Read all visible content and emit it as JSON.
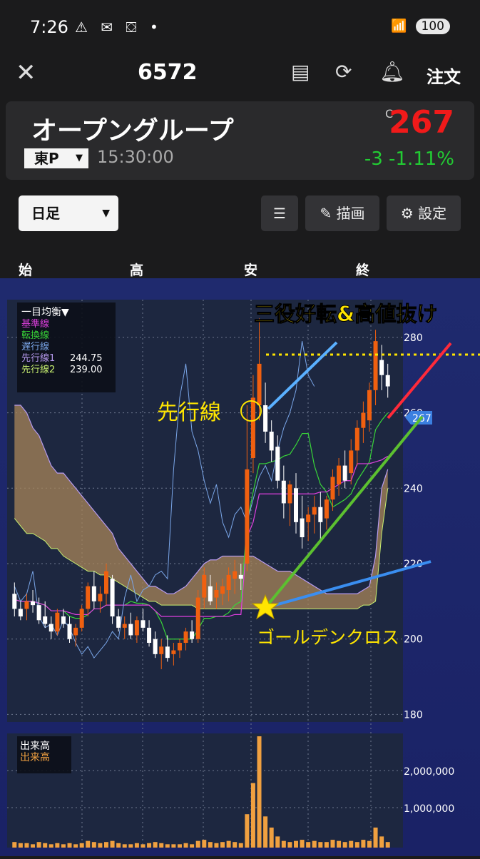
{
  "status_bar": {
    "time": "7:26",
    "icons": [
      "alert-icon",
      "mail-icon",
      "cube-icon",
      "dot-icon"
    ],
    "battery": "100",
    "signal": "5"
  },
  "header": {
    "code": "6572",
    "order_label": "注文"
  },
  "quote": {
    "name": "オープングループ",
    "market": "東P",
    "time": "15:30:00",
    "c_mark": "C",
    "price": "267",
    "change": "-3",
    "change_pct": "-1.11%",
    "price_color": "#f01a1a",
    "change_color": "#22cc33"
  },
  "controls": {
    "period": "日足",
    "draw_label": "描画",
    "settings_label": "設定"
  },
  "ohlc_labels": [
    "始",
    "高",
    "安",
    "終"
  ],
  "legend": {
    "title": "一目均衡▼",
    "kijun": "基準線",
    "tenkan": "転換線",
    "chikou": "遅行線",
    "senkou1": "先行線1",
    "senkou1_val": "244.75",
    "senkou2": "先行線2",
    "senkou2_val": "239.00"
  },
  "annotations": {
    "headline": "三役好転&高値抜け",
    "senko_label": "先行線",
    "golden_cross": "ゴールデンクロス"
  },
  "volume_legend": {
    "line1": "出来高",
    "line2": "出来高"
  },
  "chart_data": {
    "type": "candlestick",
    "y_ticks": [
      200,
      220,
      240,
      260,
      280,
      "280"
    ],
    "y_labels": [
      "280",
      "260",
      "240",
      "220",
      "200",
      "180"
    ],
    "ylim": [
      178,
      290
    ],
    "current_price_tag": "267",
    "volume_ticks": [
      "2,000,000",
      "1,000,000"
    ],
    "candles": [
      [
        212,
        215,
        206,
        208
      ],
      [
        208,
        210,
        205,
        206
      ],
      [
        208,
        212,
        205,
        210
      ],
      [
        210,
        213,
        207,
        209
      ],
      [
        209,
        211,
        204,
        205
      ],
      [
        206,
        210,
        203,
        204
      ],
      [
        204,
        206,
        200,
        202
      ],
      [
        202,
        208,
        201,
        207
      ],
      [
        206,
        208,
        203,
        204
      ],
      [
        204,
        206,
        199,
        200
      ],
      [
        201,
        204,
        198,
        203
      ],
      [
        203,
        209,
        202,
        208
      ],
      [
        208,
        215,
        206,
        214
      ],
      [
        214,
        218,
        208,
        210
      ],
      [
        210,
        214,
        207,
        212
      ],
      [
        212,
        220,
        209,
        218
      ],
      [
        216,
        217,
        204,
        206
      ],
      [
        206,
        208,
        202,
        203
      ],
      [
        203,
        206,
        200,
        204
      ],
      [
        204,
        207,
        200,
        201
      ],
      [
        201,
        206,
        199,
        205
      ],
      [
        205,
        208,
        202,
        203
      ],
      [
        203,
        205,
        198,
        199
      ],
      [
        200,
        202,
        195,
        196
      ],
      [
        196,
        200,
        192,
        198
      ],
      [
        198,
        201,
        194,
        195
      ],
      [
        196,
        199,
        193,
        197
      ],
      [
        197,
        200,
        195,
        199
      ],
      [
        199,
        203,
        197,
        202
      ],
      [
        202,
        205,
        199,
        200
      ],
      [
        200,
        213,
        199,
        211
      ],
      [
        211,
        219,
        208,
        217
      ],
      [
        214,
        217,
        209,
        210
      ],
      [
        211,
        215,
        208,
        213
      ],
      [
        212,
        216,
        209,
        214
      ],
      [
        213,
        219,
        210,
        217
      ],
      [
        216,
        221,
        212,
        218
      ],
      [
        217,
        220,
        213,
        216
      ],
      [
        220,
        262,
        218,
        245
      ],
      [
        248,
        270,
        244,
        264
      ],
      [
        262,
        285,
        258,
        273
      ],
      [
        262,
        268,
        252,
        255
      ],
      [
        255,
        258,
        247,
        250
      ],
      [
        251,
        254,
        240,
        242
      ],
      [
        242,
        246,
        232,
        236
      ],
      [
        236,
        242,
        230,
        241
      ],
      [
        240,
        244,
        228,
        231
      ],
      [
        232,
        238,
        224,
        227
      ],
      [
        231,
        235,
        226,
        233
      ],
      [
        233,
        238,
        228,
        235
      ],
      [
        235,
        239,
        226,
        231
      ],
      [
        232,
        238,
        229,
        237
      ],
      [
        237,
        245,
        234,
        243
      ],
      [
        241,
        248,
        238,
        246
      ],
      [
        246,
        250,
        240,
        242
      ],
      [
        244,
        253,
        241,
        250
      ],
      [
        250,
        258,
        246,
        256
      ],
      [
        256,
        263,
        252,
        260
      ],
      [
        258,
        268,
        255,
        266
      ],
      [
        266,
        282,
        262,
        279
      ],
      [
        274,
        278,
        266,
        270
      ],
      [
        270,
        273,
        264,
        267
      ]
    ],
    "volumes": [
      0.05,
      0.04,
      0.04,
      0.03,
      0.05,
      0.04,
      0.03,
      0.04,
      0.03,
      0.04,
      0.03,
      0.04,
      0.06,
      0.05,
      0.04,
      0.05,
      0.06,
      0.04,
      0.03,
      0.03,
      0.04,
      0.03,
      0.04,
      0.05,
      0.04,
      0.03,
      0.03,
      0.03,
      0.04,
      0.03,
      0.06,
      0.07,
      0.05,
      0.04,
      0.05,
      0.06,
      0.05,
      0.04,
      0.3,
      0.58,
      1.0,
      0.28,
      0.18,
      0.1,
      0.06,
      0.05,
      0.06,
      0.07,
      0.05,
      0.06,
      0.05,
      0.05,
      0.07,
      0.06,
      0.05,
      0.06,
      0.05,
      0.07,
      0.06,
      0.18,
      0.1,
      0.05
    ]
  }
}
